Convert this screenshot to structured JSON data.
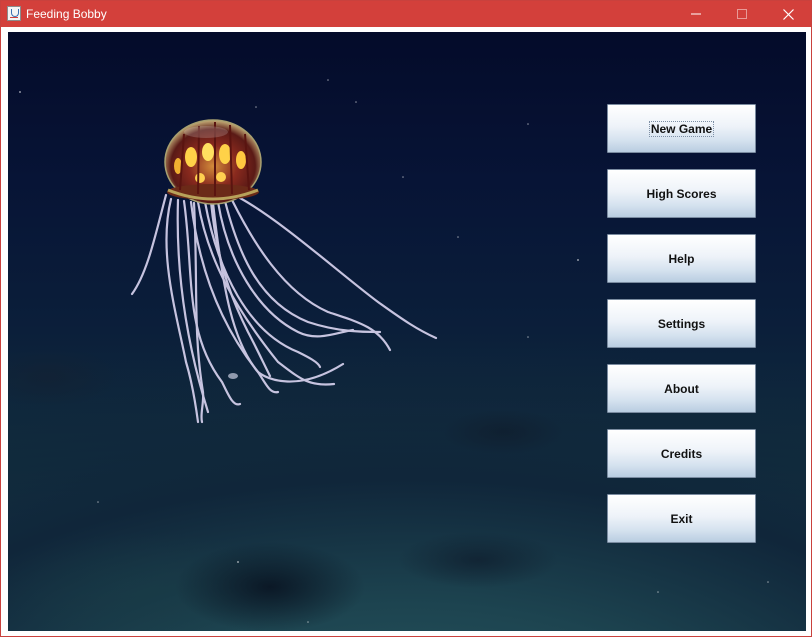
{
  "window": {
    "title": "Feeding Bobby"
  },
  "titlebar_icons": {
    "app": "java-cup-icon",
    "minimize": "minimize-icon",
    "maximize": "maximize-icon",
    "close": "close-icon"
  },
  "scene": {
    "image": "deep-sea jellyfish background"
  },
  "menu": [
    {
      "label": "New Game",
      "focused": true
    },
    {
      "label": "High Scores"
    },
    {
      "label": "Help"
    },
    {
      "label": "Settings"
    },
    {
      "label": "About"
    },
    {
      "label": "Credits"
    },
    {
      "label": "Exit"
    }
  ],
  "colors": {
    "titlebar": "#d3403b",
    "ocean_top": "#040b2a",
    "ocean_bottom": "#1a4651",
    "button_top": "#ffffff",
    "button_bottom": "#b9cde1"
  }
}
